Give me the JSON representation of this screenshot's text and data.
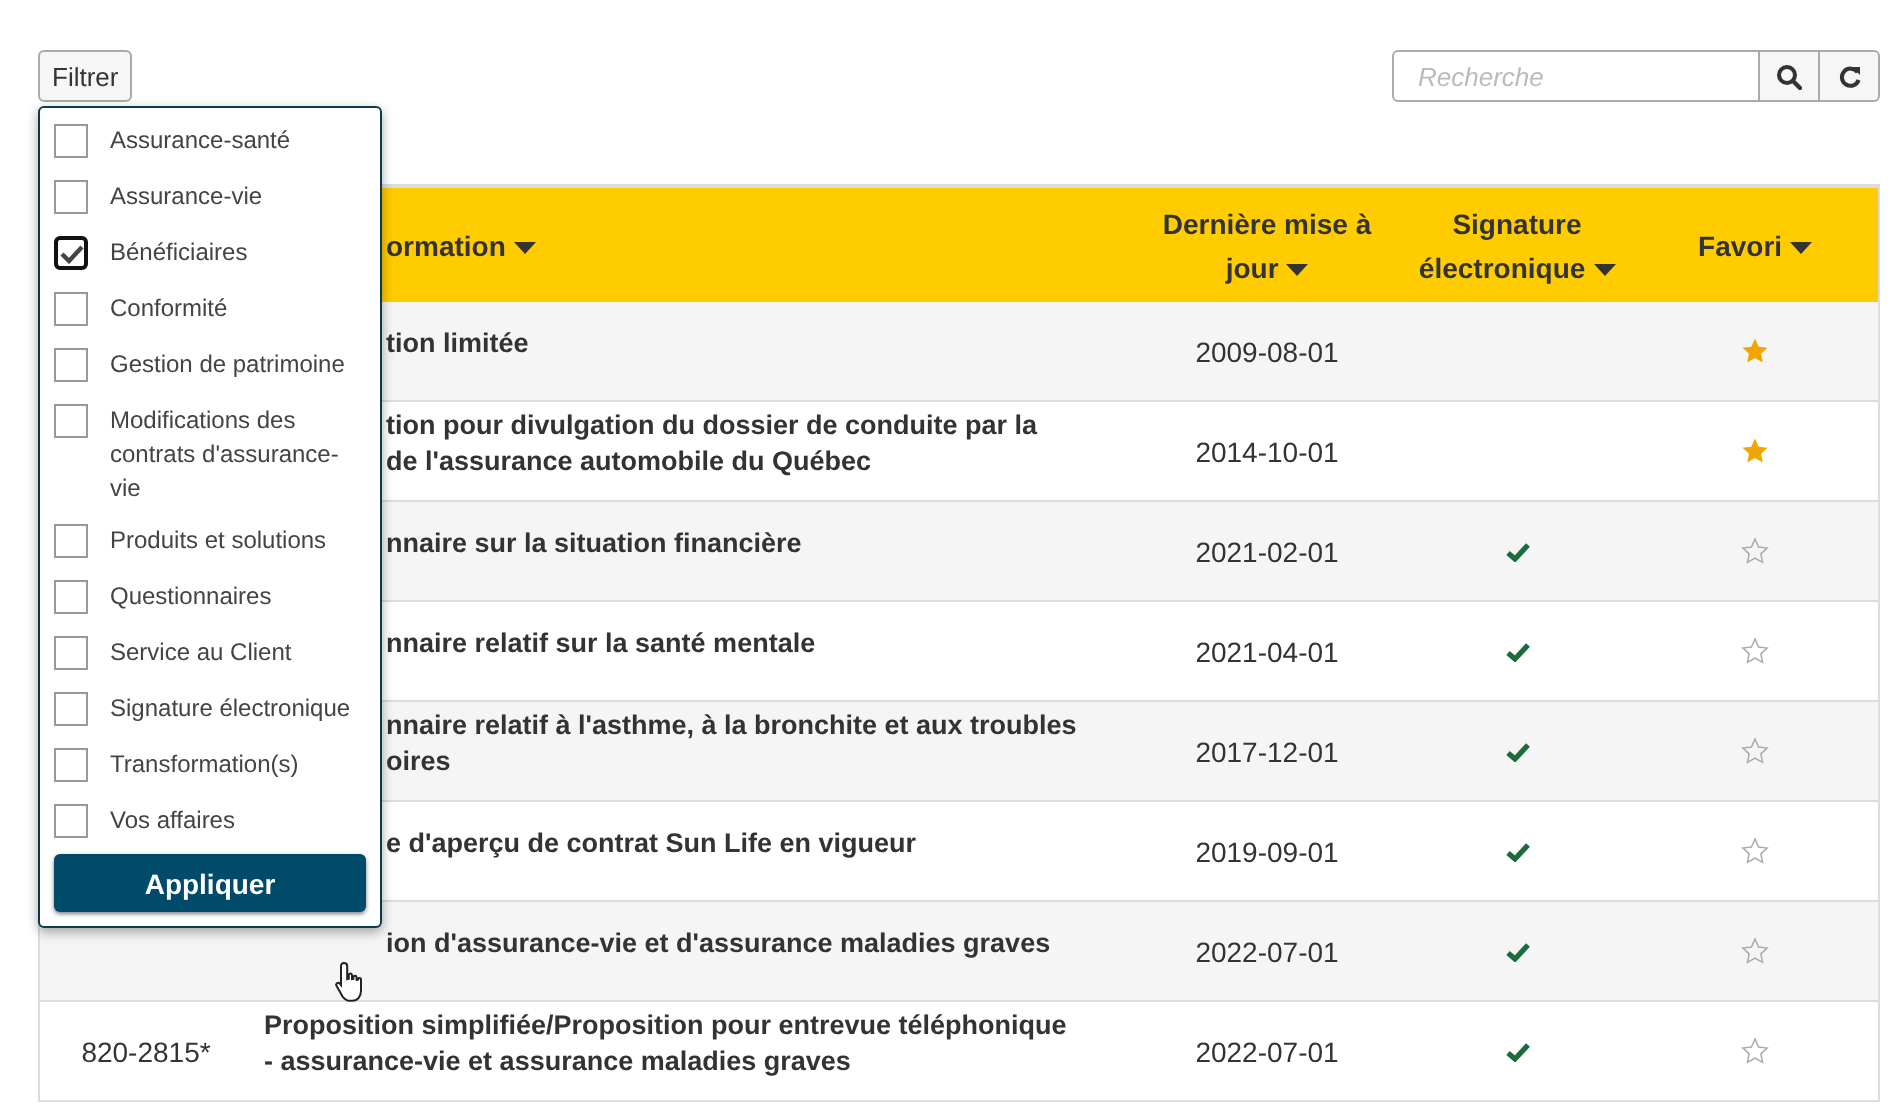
{
  "toolbar": {
    "filter_button": "Filtrer",
    "search": {
      "placeholder": "Recherche"
    }
  },
  "filter_menu": {
    "items": [
      {
        "label": "Assurance-santé",
        "checked": false
      },
      {
        "label": "Assurance-vie",
        "checked": false
      },
      {
        "label": "Bénéficiaires",
        "checked": true
      },
      {
        "label": "Conformité",
        "checked": false
      },
      {
        "label": "Gestion de patrimoine",
        "checked": false
      },
      {
        "label": "Modifications des contrats d'assurance-vie",
        "checked": false
      },
      {
        "label": "Produits et solutions",
        "checked": false
      },
      {
        "label": "Questionnaires",
        "checked": false
      },
      {
        "label": "Service au Client",
        "checked": false
      },
      {
        "label": "Signature électronique",
        "checked": false
      },
      {
        "label": "Transformation(s)",
        "checked": false
      },
      {
        "label": "Vos affaires",
        "checked": false
      }
    ],
    "apply_button": "Appliquer"
  },
  "table": {
    "columns": [
      {
        "kind": "title",
        "label": "ormation",
        "sortable": true
      },
      {
        "kind": "date",
        "label": "Dernière mise à jour",
        "sortable": true
      },
      {
        "kind": "esign",
        "label": "Signature électronique",
        "sortable": true
      },
      {
        "kind": "favorite",
        "label": "Favori",
        "sortable": true
      }
    ],
    "rows": [
      {
        "title_lines": [
          "tion limitée"
        ],
        "updated": "2009-08-01",
        "esign": false,
        "favorite": true
      },
      {
        "title_lines": [
          "tion pour divulgation du dossier de conduite par la",
          "de l'assurance automobile du Québec"
        ],
        "updated": "2014-10-01",
        "esign": false,
        "favorite": true
      },
      {
        "title_lines": [
          "nnaire sur la situation financière"
        ],
        "updated": "2021-02-01",
        "esign": true,
        "favorite": false
      },
      {
        "title_lines": [
          "nnaire relatif sur la santé mentale"
        ],
        "updated": "2021-04-01",
        "esign": true,
        "favorite": false
      },
      {
        "title_lines": [
          "nnaire relatif à l'asthme, à la bronchite et aux troubles",
          "oires"
        ],
        "updated": "2017-12-01",
        "esign": true,
        "favorite": false
      },
      {
        "title_lines": [
          "e d'aperçu de contrat Sun Life en vigueur"
        ],
        "updated": "2019-09-01",
        "esign": true,
        "favorite": false
      },
      {
        "title_lines": [
          "ion d'assurance-vie et d'assurance maladies graves"
        ],
        "updated": "2022-07-01",
        "esign": true,
        "favorite": false
      },
      {
        "number": "820-2815*",
        "title_lines": [
          "Proposition simplifiée/Proposition pour entrevue téléphonique",
          "- assurance-vie et assurance maladies graves"
        ],
        "updated": "2022-07-01",
        "esign": true,
        "favorite": false
      }
    ]
  }
}
